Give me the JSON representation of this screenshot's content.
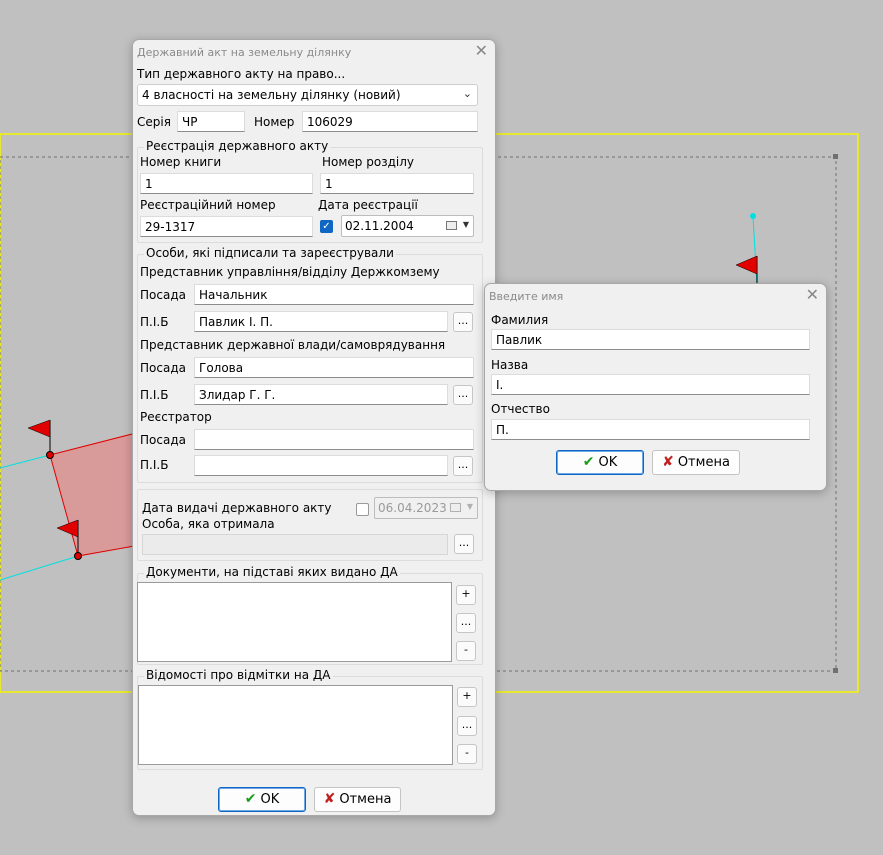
{
  "main_dialog": {
    "title": "Державний акт на земельну ділянку",
    "type_label": "Тип державного акту на право...",
    "type_value": "4 власності на земельну ділянку (новий)",
    "series_label": "Серія",
    "series_value": "ЧР",
    "number_label": "Номер",
    "number_value": "106029",
    "registration_group": {
      "title": "Реєстрація державного акту",
      "book_label": "Номер книги",
      "book_value": "1",
      "section_label": "Номер розділу",
      "section_value": "1",
      "reg_number_label": "Реєстраційний номер",
      "reg_number_value": "29-1317",
      "reg_date_label": "Дата реєстрації",
      "reg_date_value": "02.11.2004",
      "reg_date_checked": true
    },
    "persons_group": {
      "title": "Особи, які підписали та зареєстрували",
      "rep1_title": "Представник управління/відділу Держкомзему",
      "position_label": "Посада",
      "name_label": "П.І.Б",
      "rep1_position": "Начальник",
      "rep1_name": "Павлик І. П.",
      "rep2_title": "Представник державної влади/самоврядування",
      "rep2_position": "Голова",
      "rep2_name": "Злидар Г. Г.",
      "registrar_title": "Реєстратор",
      "registrar_position": "",
      "registrar_name": "",
      "ellipsis": "..."
    },
    "issue_group": {
      "issue_date_label": "Дата видачі державного акту",
      "issue_date_value": "06.04.2023",
      "issue_date_checked": false,
      "recipient_label": "Особа, яка отримала",
      "recipient_value": ""
    },
    "documents_group": {
      "title": "Документи, на підставі яких видано ДА",
      "add": "+",
      "edit": "...",
      "remove": "-"
    },
    "marks_group": {
      "title": "Відомості про відмітки на ДА",
      "add": "+",
      "edit": "...",
      "remove": "-"
    },
    "ok_label": "OK",
    "cancel_label": "Отмена"
  },
  "name_dialog": {
    "title": "Введите имя",
    "surname_label": "Фамилия",
    "surname_value": "Павлик",
    "firstname_label": "Назва",
    "firstname_value": "І.",
    "patronymic_label": "Отчество",
    "patronymic_value": "П.",
    "ok_label": "OK",
    "cancel_label": "Отмена"
  },
  "colors": {
    "ok_check": "#1a9c1a",
    "cancel_x": "#c0201e",
    "flag": "#e00000",
    "parcel_fill": "#d99a9a",
    "boundary_yellow": "#f5f500",
    "cyan_line": "#00e0e0",
    "accent": "#0f67c3"
  }
}
